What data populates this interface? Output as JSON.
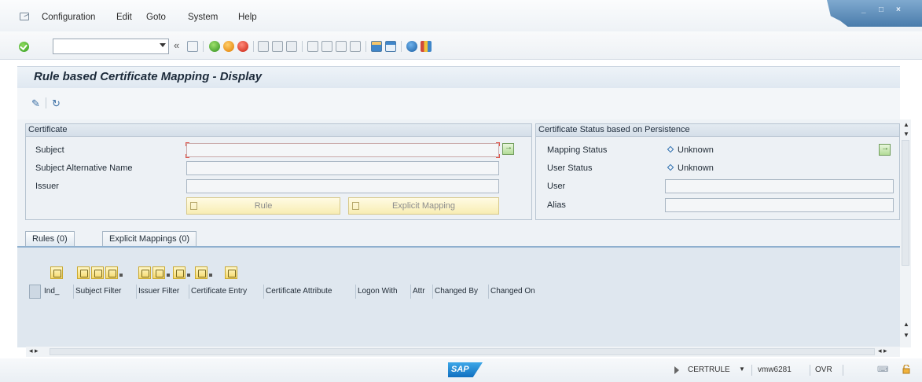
{
  "menu": {
    "items": [
      "Configuration",
      "Edit",
      "Goto",
      "System",
      "Help"
    ]
  },
  "window_controls": [
    "_",
    "□",
    "×"
  ],
  "toolbar": {
    "command_value": "",
    "double_arrow": "«",
    "icons": [
      "save-icon",
      "back-icon",
      "exit-icon",
      "cancel-icon",
      "print-icon",
      "find-icon",
      "find-next-icon",
      "first-page-icon",
      "previous-page-icon",
      "next-page-icon",
      "last-page-icon",
      "create-session-icon",
      "shortcut-icon",
      "help-icon",
      "customize-layout-icon"
    ]
  },
  "title": "Rule based Certificate Mapping - Display",
  "certificate": {
    "header": "Certificate",
    "subject_label": "Subject",
    "subject_value": "",
    "san_label": "Subject Alternative Name",
    "san_value": "",
    "issuer_label": "Issuer",
    "issuer_value": "",
    "rule_button": "Rule",
    "explicit_button": "Explicit Mapping"
  },
  "status": {
    "header": "Certificate Status based on Persistence",
    "mapping_label": "Mapping Status",
    "mapping_value": "Unknown",
    "user_status_label": "User Status",
    "user_status_value": "Unknown",
    "user_label": "User",
    "user_value": "",
    "alias_label": "Alias",
    "alias_value": ""
  },
  "tabs": [
    "Rules (0)",
    "Explicit Mappings (0)"
  ],
  "alv": {
    "columns": [
      "Ind_",
      "Subject Filter",
      "Issuer Filter",
      "Certificate Entry",
      "Certificate Attribute",
      "Logon With",
      "Attr",
      "Changed By",
      "Changed On"
    ]
  },
  "statusbar": {
    "logo": "SAP",
    "transaction": "CERTRULE",
    "server": "vmw6281",
    "mode": "OVR"
  }
}
